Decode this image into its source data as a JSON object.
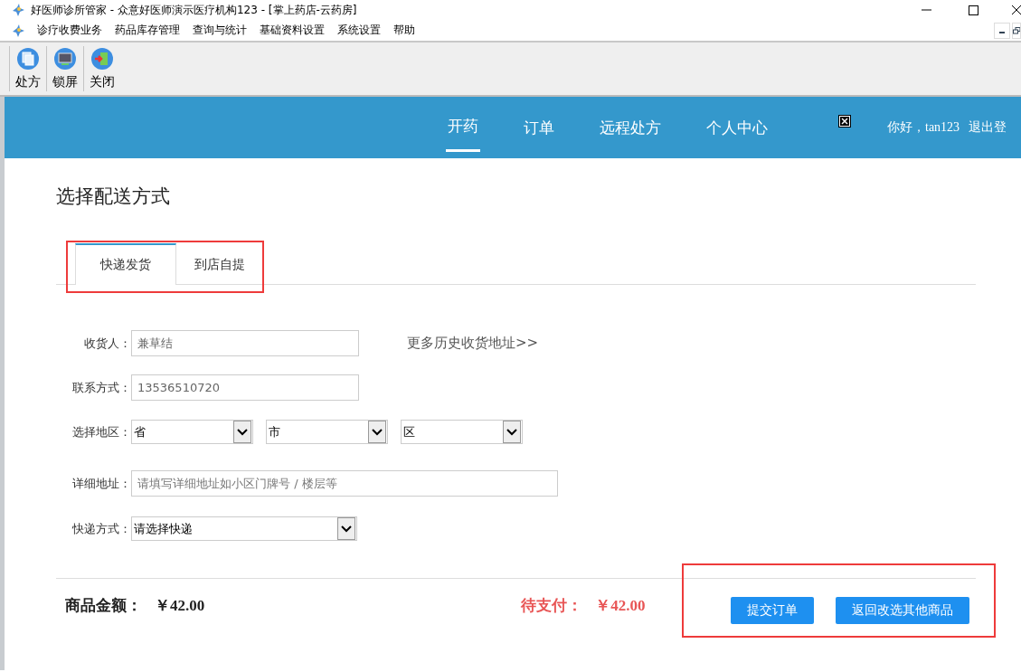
{
  "window": {
    "title": "好医师诊所管家 - 众意好医师演示医疗机构123 - [掌上药店-云药房]"
  },
  "menu": [
    {
      "label": "诊疗收费业务"
    },
    {
      "label": "药品库存管理"
    },
    {
      "label": "查询与统计"
    },
    {
      "label": "基础资料设置"
    },
    {
      "label": "系统设置"
    },
    {
      "label": "帮助"
    }
  ],
  "toolbar": [
    {
      "label": "处方"
    },
    {
      "label": "锁屏"
    },
    {
      "label": "关闭"
    }
  ],
  "nav": {
    "items": [
      {
        "label": "开药",
        "selected": true
      },
      {
        "label": "订单",
        "selected": false
      },
      {
        "label": "远程处方",
        "selected": false
      },
      {
        "label": "个人中心",
        "selected": false
      }
    ],
    "greeting": "你好，tan123",
    "logout": "退出登"
  },
  "page": {
    "heading": "选择配送方式",
    "tabs": [
      {
        "label": "快递发货",
        "selected": true
      },
      {
        "label": "到店自提",
        "selected": false
      }
    ],
    "form": [
      {
        "kind": "text",
        "label": "收货人：",
        "value": "兼草结",
        "link": "更多历史收货地址>>"
      },
      {
        "kind": "text",
        "label": "联系方式：",
        "value": "13536510720"
      },
      {
        "kind": "region",
        "label": "选择地区：",
        "selects": [
          "省",
          "市",
          "区"
        ]
      },
      {
        "kind": "wide",
        "label": "详细地址：",
        "placeholder": "请填写详细地址如小区门牌号 / 楼层等"
      },
      {
        "kind": "select",
        "label": "快递方式：",
        "value": "请选择快递"
      }
    ],
    "summary": {
      "amount_label": "商品金额：",
      "amount": "￥42.00",
      "due_label": "待支付：",
      "due": "￥42.00"
    },
    "buttons": [
      "提交订单",
      "返回改选其他商品"
    ]
  }
}
